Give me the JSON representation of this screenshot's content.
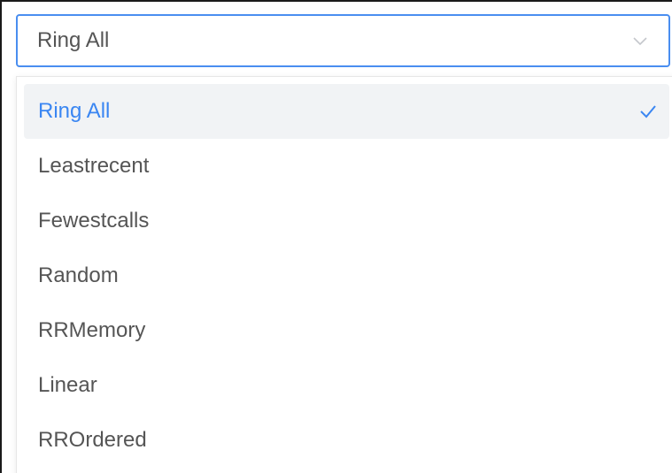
{
  "select": {
    "value": "Ring All"
  },
  "dropdown": {
    "options": [
      {
        "label": "Ring All",
        "selected": true
      },
      {
        "label": "Leastrecent",
        "selected": false
      },
      {
        "label": "Fewestcalls",
        "selected": false
      },
      {
        "label": "Random",
        "selected": false
      },
      {
        "label": "RRMemory",
        "selected": false
      },
      {
        "label": "Linear",
        "selected": false
      },
      {
        "label": "RROrdered",
        "selected": false
      }
    ]
  },
  "colors": {
    "accent": "#3a86f2",
    "focus_border": "#4a8ef0",
    "text": "#555555",
    "selected_bg": "#f1f3f5"
  },
  "icons": {
    "arrow": "chevron-down-icon",
    "selected_mark": "checkmark-icon"
  }
}
